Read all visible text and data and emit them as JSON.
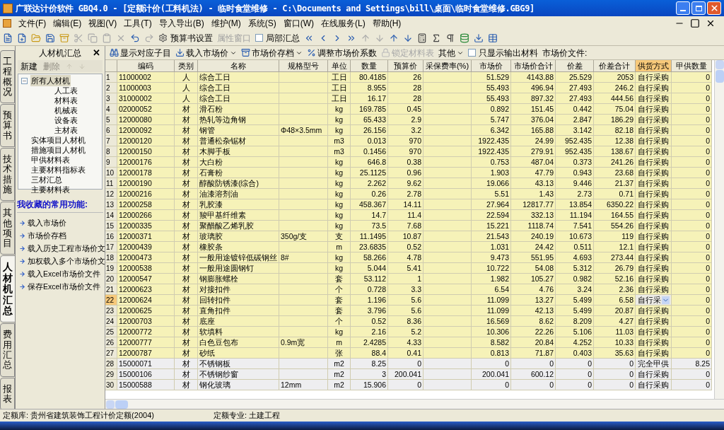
{
  "window": {
    "title": "广联达计价软件 GBQ4.0 - [定额计价(工料机法) - 临时食堂维修 - C:\\Documents and Settings\\bill\\桌面\\临时食堂维修.GBG9]"
  },
  "menu": [
    "文件(F)",
    "编辑(E)",
    "视图(V)",
    "工具(T)",
    "导入导出(B)",
    "维护(M)",
    "系统(S)",
    "窗口(W)",
    "在线服务(L)",
    "帮助(H)"
  ],
  "toolbar": [
    {
      "label": "预算书设置",
      "disabled": false,
      "kind": "button"
    },
    {
      "label": "属性窗口",
      "disabled": true,
      "kind": "button"
    },
    {
      "label": "局部汇总",
      "disabled": false,
      "kind": "check",
      "checked": false
    }
  ],
  "side_tabs": [
    {
      "label": "工程概况",
      "selected": false
    },
    {
      "label": "预算书",
      "selected": false
    },
    {
      "label": "技术措施",
      "selected": false
    },
    {
      "label": "其他项目",
      "selected": false
    },
    {
      "label": "人材机汇总",
      "selected": true
    },
    {
      "label": "费用汇总",
      "selected": false
    },
    {
      "label": "报表",
      "selected": false
    }
  ],
  "panel": {
    "title": "人材机汇总",
    "close": "✕",
    "actions": [
      {
        "label": "新建",
        "disabled": false
      },
      {
        "label": "删除",
        "disabled": true
      }
    ],
    "tree": [
      {
        "label": "所有人材机",
        "selected": true,
        "expanded": true,
        "children": [
          {
            "label": "人工表",
            "selected": false
          },
          {
            "label": "材料表",
            "selected": false
          },
          {
            "label": "机械表",
            "selected": false
          },
          {
            "label": "设备表",
            "selected": false
          },
          {
            "label": "主材表",
            "selected": false
          }
        ]
      },
      {
        "label": "实体项目人材机",
        "selected": false
      },
      {
        "label": "措施项目人材机",
        "selected": false
      },
      {
        "label": "甲供材料表",
        "selected": false
      },
      {
        "label": "主要材料指标表",
        "selected": false
      },
      {
        "label": "三材汇总",
        "selected": false
      },
      {
        "label": "主要材料表",
        "selected": false
      }
    ],
    "favorites_title": "我收藏的常用功能:",
    "favorites": [
      "载入市场价",
      "市场价存档",
      "载入历史工程市场价文",
      "加权载入多个市场价文",
      "载入Excel市场价文件",
      "保存Excel市场价文件"
    ]
  },
  "grid_toolbar": [
    {
      "label": "显示对应子目",
      "kind": "button",
      "disabled": false
    },
    {
      "label": "载入市场价",
      "kind": "menu",
      "disabled": false
    },
    {
      "label": "市场价存档",
      "kind": "menu",
      "disabled": false
    },
    {
      "label": "调整市场价系数",
      "kind": "button",
      "disabled": false
    },
    {
      "label": "锁定材料表",
      "kind": "button",
      "disabled": true
    },
    {
      "label": "其他",
      "kind": "menu",
      "disabled": false
    },
    {
      "label": "只显示输出材料",
      "kind": "check",
      "disabled": false,
      "checked": false
    },
    {
      "label": "市场价文件:",
      "kind": "text"
    }
  ],
  "table": {
    "columns": [
      {
        "label": "编码",
        "sorted": false
      },
      {
        "label": "类别",
        "sorted": false
      },
      {
        "label": "名称",
        "sorted": false
      },
      {
        "label": "规格型号",
        "sorted": false
      },
      {
        "label": "单位",
        "sorted": false
      },
      {
        "label": "数量",
        "sorted": false
      },
      {
        "label": "预算价",
        "sorted": false
      },
      {
        "label": "采保费率(%)",
        "sorted": false
      },
      {
        "label": "市场价",
        "sorted": false
      },
      {
        "label": "市场价合计",
        "sorted": false
      },
      {
        "label": "价差",
        "sorted": false
      },
      {
        "label": "价差合计",
        "sorted": false
      },
      {
        "label": "供货方式",
        "sorted": true
      },
      {
        "label": "甲供数量",
        "sorted": false
      }
    ],
    "rows": [
      {
        "no": "1",
        "cells": [
          "11000002",
          "人",
          "综合工日",
          null,
          "工日",
          "80.4185",
          "26",
          null,
          "51.529",
          "4143.88",
          "25.529",
          "2053",
          "自行采购",
          "0"
        ],
        "selected": false,
        "highlight": true
      },
      {
        "no": "2",
        "cells": [
          "11000003",
          "人",
          "综合工日",
          null,
          "工日",
          "8.955",
          "28",
          null,
          "55.493",
          "496.94",
          "27.493",
          "246.2",
          "自行采购",
          "0"
        ],
        "selected": false,
        "highlight": true
      },
      {
        "no": "3",
        "cells": [
          "31000002",
          "人",
          "综合工日",
          null,
          "工日",
          "16.17",
          "28",
          null,
          "55.493",
          "897.32",
          "27.493",
          "444.56",
          "自行采购",
          "0"
        ],
        "selected": false,
        "highlight": true
      },
      {
        "no": "4",
        "cells": [
          "02000052",
          "材",
          "滑石粉",
          null,
          "kg",
          "169.785",
          "0.45",
          null,
          "0.892",
          "151.45",
          "0.442",
          "75.04",
          "自行采购",
          "0"
        ],
        "selected": false,
        "highlight": true
      },
      {
        "no": "5",
        "cells": [
          "12000080",
          "材",
          "热轧等边角钢",
          null,
          "kg",
          "65.433",
          "2.9",
          null,
          "5.747",
          "376.04",
          "2.847",
          "186.29",
          "自行采购",
          "0"
        ],
        "selected": false,
        "highlight": true
      },
      {
        "no": "6",
        "cells": [
          "12000092",
          "材",
          "钢管",
          "Φ48×3.5mm",
          "kg",
          "26.156",
          "3.2",
          null,
          "6.342",
          "165.88",
          "3.142",
          "82.18",
          "自行采购",
          "0"
        ],
        "selected": false,
        "highlight": true
      },
      {
        "no": "7",
        "cells": [
          "12000120",
          "材",
          "普通松杂锯材",
          null,
          "m3",
          "0.013",
          "970",
          null,
          "1922.435",
          "24.99",
          "952.435",
          "12.38",
          "自行采购",
          "0"
        ],
        "selected": false,
        "highlight": true
      },
      {
        "no": "8",
        "cells": [
          "12000150",
          "材",
          "木脚手板",
          null,
          "m3",
          "0.1456",
          "970",
          null,
          "1922.435",
          "279.91",
          "952.435",
          "138.67",
          "自行采购",
          "0"
        ],
        "selected": false,
        "highlight": true
      },
      {
        "no": "9",
        "cells": [
          "12000176",
          "材",
          "大白粉",
          null,
          "kg",
          "646.8",
          "0.38",
          null,
          "0.753",
          "487.04",
          "0.373",
          "241.26",
          "自行采购",
          "0"
        ],
        "selected": false,
        "highlight": true
      },
      {
        "no": "10",
        "cells": [
          "12000178",
          "材",
          "石膏粉",
          null,
          "kg",
          "25.1125",
          "0.96",
          null,
          "1.903",
          "47.79",
          "0.943",
          "23.68",
          "自行采购",
          "0"
        ],
        "selected": false,
        "highlight": true
      },
      {
        "no": "11",
        "cells": [
          "12000190",
          "材",
          "醇酸防锈漆(综合)",
          null,
          "kg",
          "2.262",
          "9.62",
          null,
          "19.066",
          "43.13",
          "9.446",
          "21.37",
          "自行采购",
          "0"
        ],
        "selected": false,
        "highlight": true
      },
      {
        "no": "12",
        "cells": [
          "12000216",
          "材",
          "油漆溶剂油",
          null,
          "kg",
          "0.26",
          "2.78",
          null,
          "5.51",
          "1.43",
          "2.73",
          "0.71",
          "自行采购",
          "0"
        ],
        "selected": false,
        "highlight": true
      },
      {
        "no": "13",
        "cells": [
          "12000258",
          "材",
          "乳胶漆",
          null,
          "kg",
          "458.367",
          "14.11",
          null,
          "27.964",
          "12817.77",
          "13.854",
          "6350.22",
          "自行采购",
          "0"
        ],
        "selected": false,
        "highlight": true
      },
      {
        "no": "14",
        "cells": [
          "12000266",
          "材",
          "羧甲基纤维素",
          null,
          "kg",
          "14.7",
          "11.4",
          null,
          "22.594",
          "332.13",
          "11.194",
          "164.55",
          "自行采购",
          "0"
        ],
        "selected": false,
        "highlight": true
      },
      {
        "no": "15",
        "cells": [
          "12000335",
          "材",
          "聚醋酸乙烯乳胶",
          null,
          "kg",
          "73.5",
          "7.68",
          null,
          "15.221",
          "1118.74",
          "7.541",
          "554.26",
          "自行采购",
          "0"
        ],
        "selected": false,
        "highlight": true
      },
      {
        "no": "16",
        "cells": [
          "12000371",
          "材",
          "玻璃胶",
          "350g/支",
          "支",
          "11.1495",
          "10.87",
          null,
          "21.543",
          "240.19",
          "10.673",
          "119",
          "自行采购",
          "0"
        ],
        "selected": false,
        "highlight": true
      },
      {
        "no": "17",
        "cells": [
          "12000439",
          "材",
          "橡胶条",
          null,
          "m",
          "23.6835",
          "0.52",
          null,
          "1.031",
          "24.42",
          "0.511",
          "12.1",
          "自行采购",
          "0"
        ],
        "selected": false,
        "highlight": true
      },
      {
        "no": "18",
        "cells": [
          "12000473",
          "材",
          "一般用途镀锌低碳钢丝",
          "8#",
          "kg",
          "58.266",
          "4.78",
          null,
          "9.473",
          "551.95",
          "4.693",
          "273.44",
          "自行采购",
          "0"
        ],
        "selected": false,
        "highlight": true
      },
      {
        "no": "19",
        "cells": [
          "12000538",
          "材",
          "一般用途圆钢钉",
          null,
          "kg",
          "5.044",
          "5.41",
          null,
          "10.722",
          "54.08",
          "5.312",
          "26.79",
          "自行采购",
          "0"
        ],
        "selected": false,
        "highlight": true
      },
      {
        "no": "20",
        "cells": [
          "12000547",
          "材",
          "钢膨胀螺栓",
          null,
          "套",
          "53.112",
          "1",
          null,
          "1.982",
          "105.27",
          "0.982",
          "52.16",
          "自行采购",
          "0"
        ],
        "selected": false,
        "highlight": true
      },
      {
        "no": "21",
        "cells": [
          "12000623",
          "材",
          "对接扣件",
          null,
          "个",
          "0.728",
          "3.3",
          null,
          "6.54",
          "4.76",
          "3.24",
          "2.36",
          "自行采购",
          "0"
        ],
        "selected": false,
        "highlight": true
      },
      {
        "no": "22",
        "cells": [
          "12000624",
          "材",
          "回转扣件",
          null,
          "套",
          "1.196",
          "5.6",
          null,
          "11.099",
          "13.27",
          "5.499",
          "6.58",
          "自行采",
          "0"
        ],
        "selected": true,
        "highlight": true
      },
      {
        "no": "23",
        "cells": [
          "12000625",
          "材",
          "直角扣件",
          null,
          "套",
          "3.796",
          "5.6",
          null,
          "11.099",
          "42.13",
          "5.499",
          "20.87",
          "自行采购",
          "0"
        ],
        "selected": false,
        "highlight": true
      },
      {
        "no": "24",
        "cells": [
          "12000703",
          "材",
          "底座",
          null,
          "个",
          "0.52",
          "8.36",
          null,
          "16.569",
          "8.62",
          "8.209",
          "4.27",
          "自行采购",
          "0"
        ],
        "selected": false,
        "highlight": true
      },
      {
        "no": "25",
        "cells": [
          "12000772",
          "材",
          "软填料",
          null,
          "kg",
          "2.16",
          "5.2",
          null,
          "10.306",
          "22.26",
          "5.106",
          "11.03",
          "自行采购",
          "0"
        ],
        "selected": false,
        "highlight": true
      },
      {
        "no": "26",
        "cells": [
          "12000777",
          "材",
          "白色豆包布",
          "0.9m宽",
          "m",
          "2.4285",
          "4.33",
          null,
          "8.582",
          "20.84",
          "4.252",
          "10.33",
          "自行采购",
          "0"
        ],
        "selected": false,
        "highlight": true
      },
      {
        "no": "27",
        "cells": [
          "12000787",
          "材",
          "砂纸",
          null,
          "张",
          "88.4",
          "0.41",
          null,
          "0.813",
          "71.87",
          "0.403",
          "35.63",
          "自行采购",
          "0"
        ],
        "selected": false,
        "highlight": true
      },
      {
        "no": "28",
        "cells": [
          "15000071",
          "材",
          "不锈钢板",
          null,
          "m2",
          "8.25",
          "0",
          null,
          "0",
          "0",
          "0",
          "0",
          "完全甲供",
          "8.25"
        ],
        "selected": false,
        "highlight": false
      },
      {
        "no": "29",
        "cells": [
          "15000106",
          "材",
          "不锈钢纱窗",
          null,
          "m2",
          "3",
          "200.041",
          null,
          "200.041",
          "600.12",
          "0",
          "0",
          "自行采购",
          "0"
        ],
        "selected": false,
        "highlight": false
      },
      {
        "no": "30",
        "cells": [
          "15000588",
          "材",
          "钢化玻璃",
          "12mm",
          "m2",
          "15.906",
          "0",
          null,
          "0",
          "0",
          "0",
          "0",
          "自行采购",
          "0"
        ],
        "selected": false,
        "highlight": false
      }
    ]
  },
  "status_bar": [
    {
      "label": "定额库: 贵州省建筑装饰工程计价定额(2004)"
    },
    {
      "label": "定额专业: 土建工程"
    }
  ]
}
